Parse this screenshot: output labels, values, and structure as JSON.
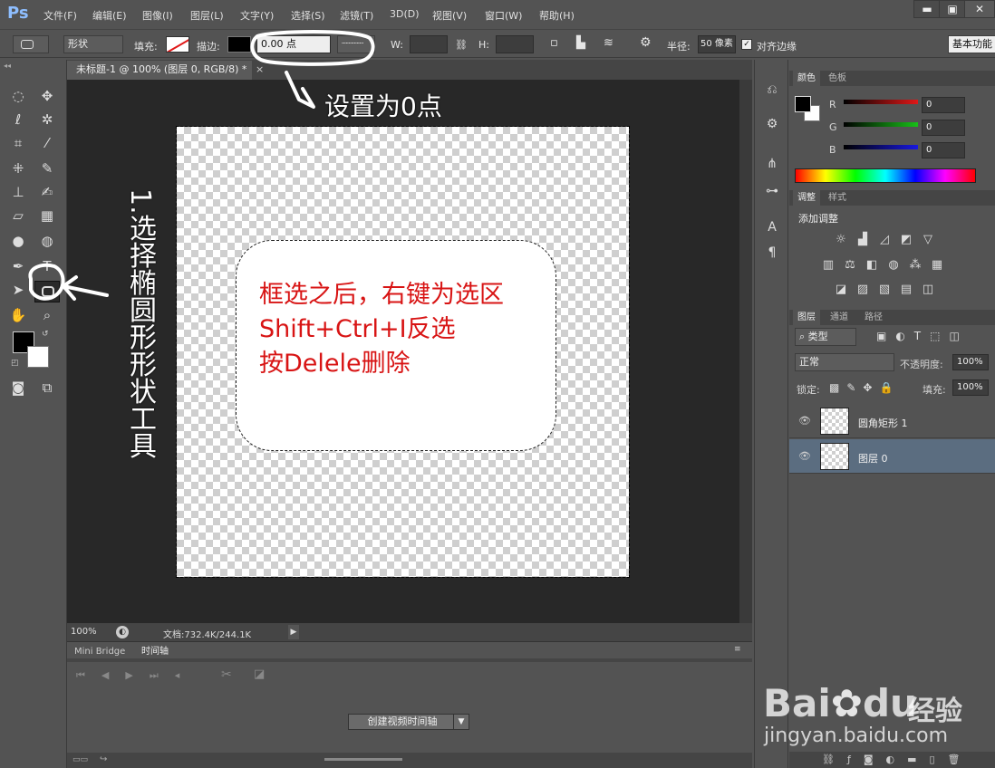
{
  "app": {
    "logo": "Ps"
  },
  "menu": [
    "文件(F)",
    "编辑(E)",
    "图像(I)",
    "图层(L)",
    "文字(Y)",
    "选择(S)",
    "滤镜(T)",
    "3D(D)",
    "视图(V)",
    "窗口(W)",
    "帮助(H)"
  ],
  "window_controls": {
    "minimize": "▬",
    "maximize": "▣",
    "close": "✕"
  },
  "options": {
    "mode": "形状",
    "fill_label": "填充:",
    "stroke_label": "描边:",
    "stroke_width": "0.00 点",
    "w_label": "W:",
    "h_label": "H:",
    "radius_label": "半径:",
    "radius_value": "50 像素",
    "align_edges": "对齐边缘",
    "workspace": "基本功能"
  },
  "document": {
    "tab_title": "未标题-1 @ 100% (图层 0, RGB/8) *"
  },
  "canvas_note": [
    "框选之后，右键为选区",
    "Shift+Ctrl+I反选",
    "按Delele删除"
  ],
  "status": {
    "zoom": "100%",
    "doc_info": "文档:732.4K/244.1K"
  },
  "timeline": {
    "tabs": [
      "Mini Bridge",
      "时间轴"
    ],
    "create_button": "创建视频时间轴"
  },
  "color_panel": {
    "tabs": [
      "颜色",
      "色板"
    ],
    "channels": [
      {
        "label": "R",
        "value": "0",
        "color": "#e01818"
      },
      {
        "label": "G",
        "value": "0",
        "color": "#18c018"
      },
      {
        "label": "B",
        "value": "0",
        "color": "#1818e0"
      }
    ]
  },
  "adjust_panel": {
    "tabs": [
      "调整",
      "样式"
    ],
    "title": "添加调整"
  },
  "layers_panel": {
    "tabs": [
      "图层",
      "通道",
      "路径"
    ],
    "filter": "类型",
    "blend_mode": "正常",
    "opacity_label": "不透明度:",
    "opacity": "100%",
    "lock_label": "锁定:",
    "fill_label": "填充:",
    "fill": "100%",
    "layers": [
      {
        "name": "圆角矩形 1",
        "selected": false
      },
      {
        "name": "图层 0",
        "selected": true
      }
    ]
  },
  "annotations": {
    "top": "设置为0点",
    "left": "1.选择椭圆形形状工具"
  },
  "watermark": {
    "brand": "Bai",
    "brand_right": "du",
    "cn": "经验",
    "url": "jingyan.baidu.com"
  },
  "colors": {
    "accent_red": "#d81414",
    "ps_blue": "#8ebeff"
  }
}
